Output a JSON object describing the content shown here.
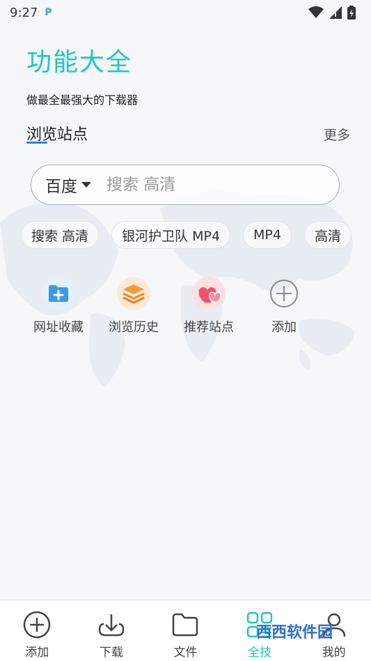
{
  "status_bar": {
    "time": "9:27",
    "app_badge": "P"
  },
  "header": {
    "title": "功能大全",
    "subtitle": "做最全最强大的下载器"
  },
  "browse": {
    "section_title": "浏览站点",
    "more_label": "更多"
  },
  "search": {
    "engine": "百度",
    "placeholder": "搜索 高清"
  },
  "chips": [
    "搜索 高清",
    "银河护卫队 MP4",
    "MP4",
    "高清"
  ],
  "quick_actions": [
    {
      "label": "网址收藏",
      "icon": "folder-add-icon"
    },
    {
      "label": "浏览历史",
      "icon": "layers-icon"
    },
    {
      "label": "推荐站点",
      "icon": "hearts-icon"
    },
    {
      "label": "添加",
      "icon": "plus-circle-icon"
    }
  ],
  "bottom_nav": [
    {
      "label": "添加",
      "icon": "plus-circle-icon"
    },
    {
      "label": "下载",
      "icon": "download-icon"
    },
    {
      "label": "文件",
      "icon": "folder-icon"
    },
    {
      "label": "全技",
      "icon": "grid-icon",
      "active": true
    },
    {
      "label": "我的",
      "icon": "user-icon"
    }
  ],
  "watermark": {
    "text": "西西软件园"
  },
  "colors": {
    "accent": "#1fc7c1",
    "underline": "#2d7fe0",
    "text": "#222222"
  }
}
